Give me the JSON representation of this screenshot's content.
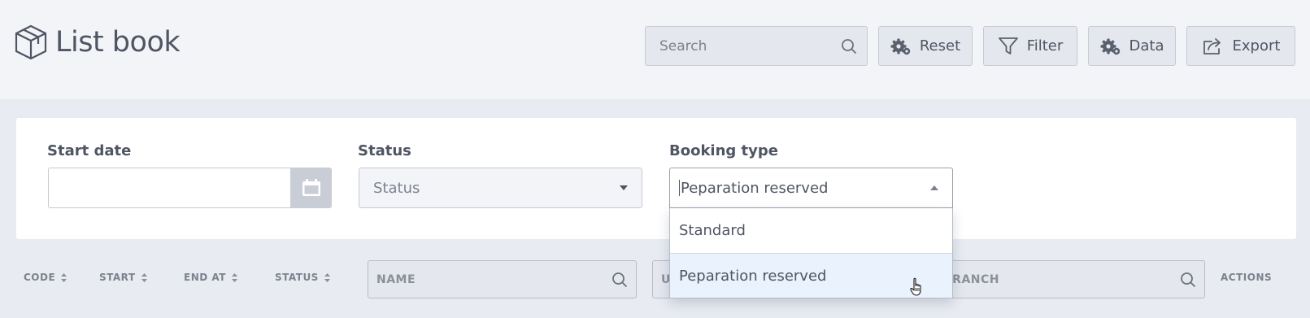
{
  "header": {
    "title": "List book",
    "logo_icon": "box-icon"
  },
  "toolbar": {
    "search_placeholder": "Search",
    "reset_label": "Reset",
    "filter_label": "Filter",
    "data_label": "Data",
    "export_label": "Export"
  },
  "filters": {
    "start_date": {
      "label": "Start date",
      "value": ""
    },
    "status": {
      "label": "Status",
      "placeholder": "Status"
    },
    "booking_type": {
      "label": "Booking type",
      "value": "Peparation reserved",
      "options": [
        "Standard",
        "Peparation reserved"
      ],
      "hovered_option": "Peparation reserved"
    }
  },
  "table": {
    "columns": {
      "code": "CODE",
      "start": "START",
      "end_at": "END AT",
      "status": "STATUS",
      "actions": "ACTIONS"
    },
    "search_fields": {
      "name_placeholder": "NAME",
      "user_placeholder": "USER",
      "branch_placeholder": "BRANCH"
    }
  },
  "colors": {
    "topbar_bg": "#f2f4f8",
    "page_bg": "#e8ebf2",
    "hover_option_bg": "#e9f2fd",
    "text": "#4f5563"
  }
}
